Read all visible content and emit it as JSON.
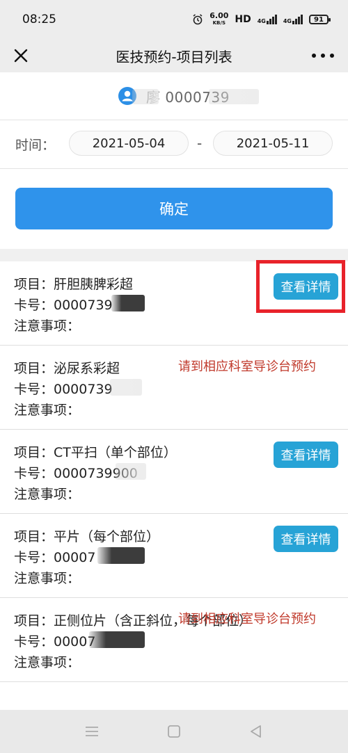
{
  "status_bar": {
    "time": "08:25",
    "net_speed_value": "6.00",
    "net_speed_unit": "KB/S",
    "hd_label": "HD",
    "signal_1_label": "4G",
    "signal_2_label": "4G",
    "battery": "91"
  },
  "nav": {
    "title": "医技预约-项目列表"
  },
  "patient": {
    "text": "廖    0000739"
  },
  "date_filter": {
    "label": "时间：",
    "start_date": "2021-05-04",
    "separator": "-",
    "end_date": "2021-05-11"
  },
  "confirm": {
    "label": "确定"
  },
  "items": [
    {
      "project": "项目：肝胆胰脾彩超",
      "card": "卡号：0000739",
      "note": "注意事项：",
      "action": "查看详情"
    },
    {
      "project": "项目：泌尿系彩超",
      "card": "卡号：0000739",
      "note": "注意事项：",
      "notice": "请到相应科室导诊台预约"
    },
    {
      "project": "项目：CT平扫（单个部位）",
      "card": "卡号：0000739900",
      "note": "注意事项：",
      "action": "查看详情"
    },
    {
      "project": "项目：平片（每个部位）",
      "card": "卡号：00007",
      "note": "注意事项：",
      "action": "查看详情"
    },
    {
      "project": "项目：正侧位片（含正斜位，每个部位）",
      "card": "卡号：00007",
      "note": "注意事项：",
      "notice": "请到相应科室导诊台预约"
    }
  ],
  "colors": {
    "primary_blue": "#2f93eb",
    "detail_button": "#27a3d6",
    "notice_red": "#c0392b",
    "highlight_red": "#e8222a"
  }
}
